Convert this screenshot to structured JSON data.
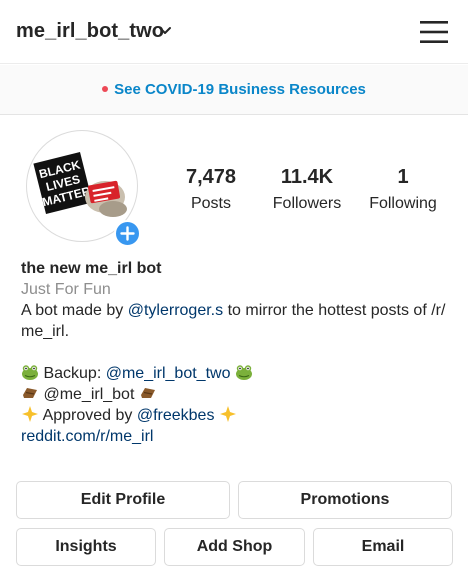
{
  "header": {
    "username": "me_irl_bot_two"
  },
  "banner": {
    "text": "See COVID-19 Business Resources"
  },
  "avatar": {
    "sign_lines": [
      "BLACK",
      "LIVES",
      "MATTER"
    ]
  },
  "stats": [
    {
      "value": "7,478",
      "label": "Posts"
    },
    {
      "value": "11.4K",
      "label": "Followers"
    },
    {
      "value": "1",
      "label": "Following"
    }
  ],
  "bio": {
    "name": "the new me_irl bot",
    "category": "Just For Fun",
    "desc_before": "A bot made by ",
    "desc_mention": "@tylerroger.s",
    "desc_after_1": " to mirror the hottest posts of /r/",
    "desc_after_2": "me_irl.",
    "backup_label": "Backup: ",
    "backup_mention": "@me_irl_bot_two",
    "coffin_handle": "@me_irl_bot",
    "approved_label": "Approved by ",
    "approved_mention": "@freekbes",
    "website": "reddit.com/r/me_irl"
  },
  "buttons": {
    "edit_profile": "Edit Profile",
    "promotions": "Promotions",
    "insights": "Insights",
    "add_shop": "Add Shop",
    "email": "Email"
  },
  "icons": {
    "frog": "frog-emoji-icon",
    "coffin": "coffin-emoji-icon",
    "glowing_star": "glowing-star-emoji-icon"
  },
  "colors": {
    "link": "#00376b",
    "banner_link": "#0a86c9",
    "accent_blue": "#3897f0",
    "secondary_text": "#8e8e8e"
  }
}
